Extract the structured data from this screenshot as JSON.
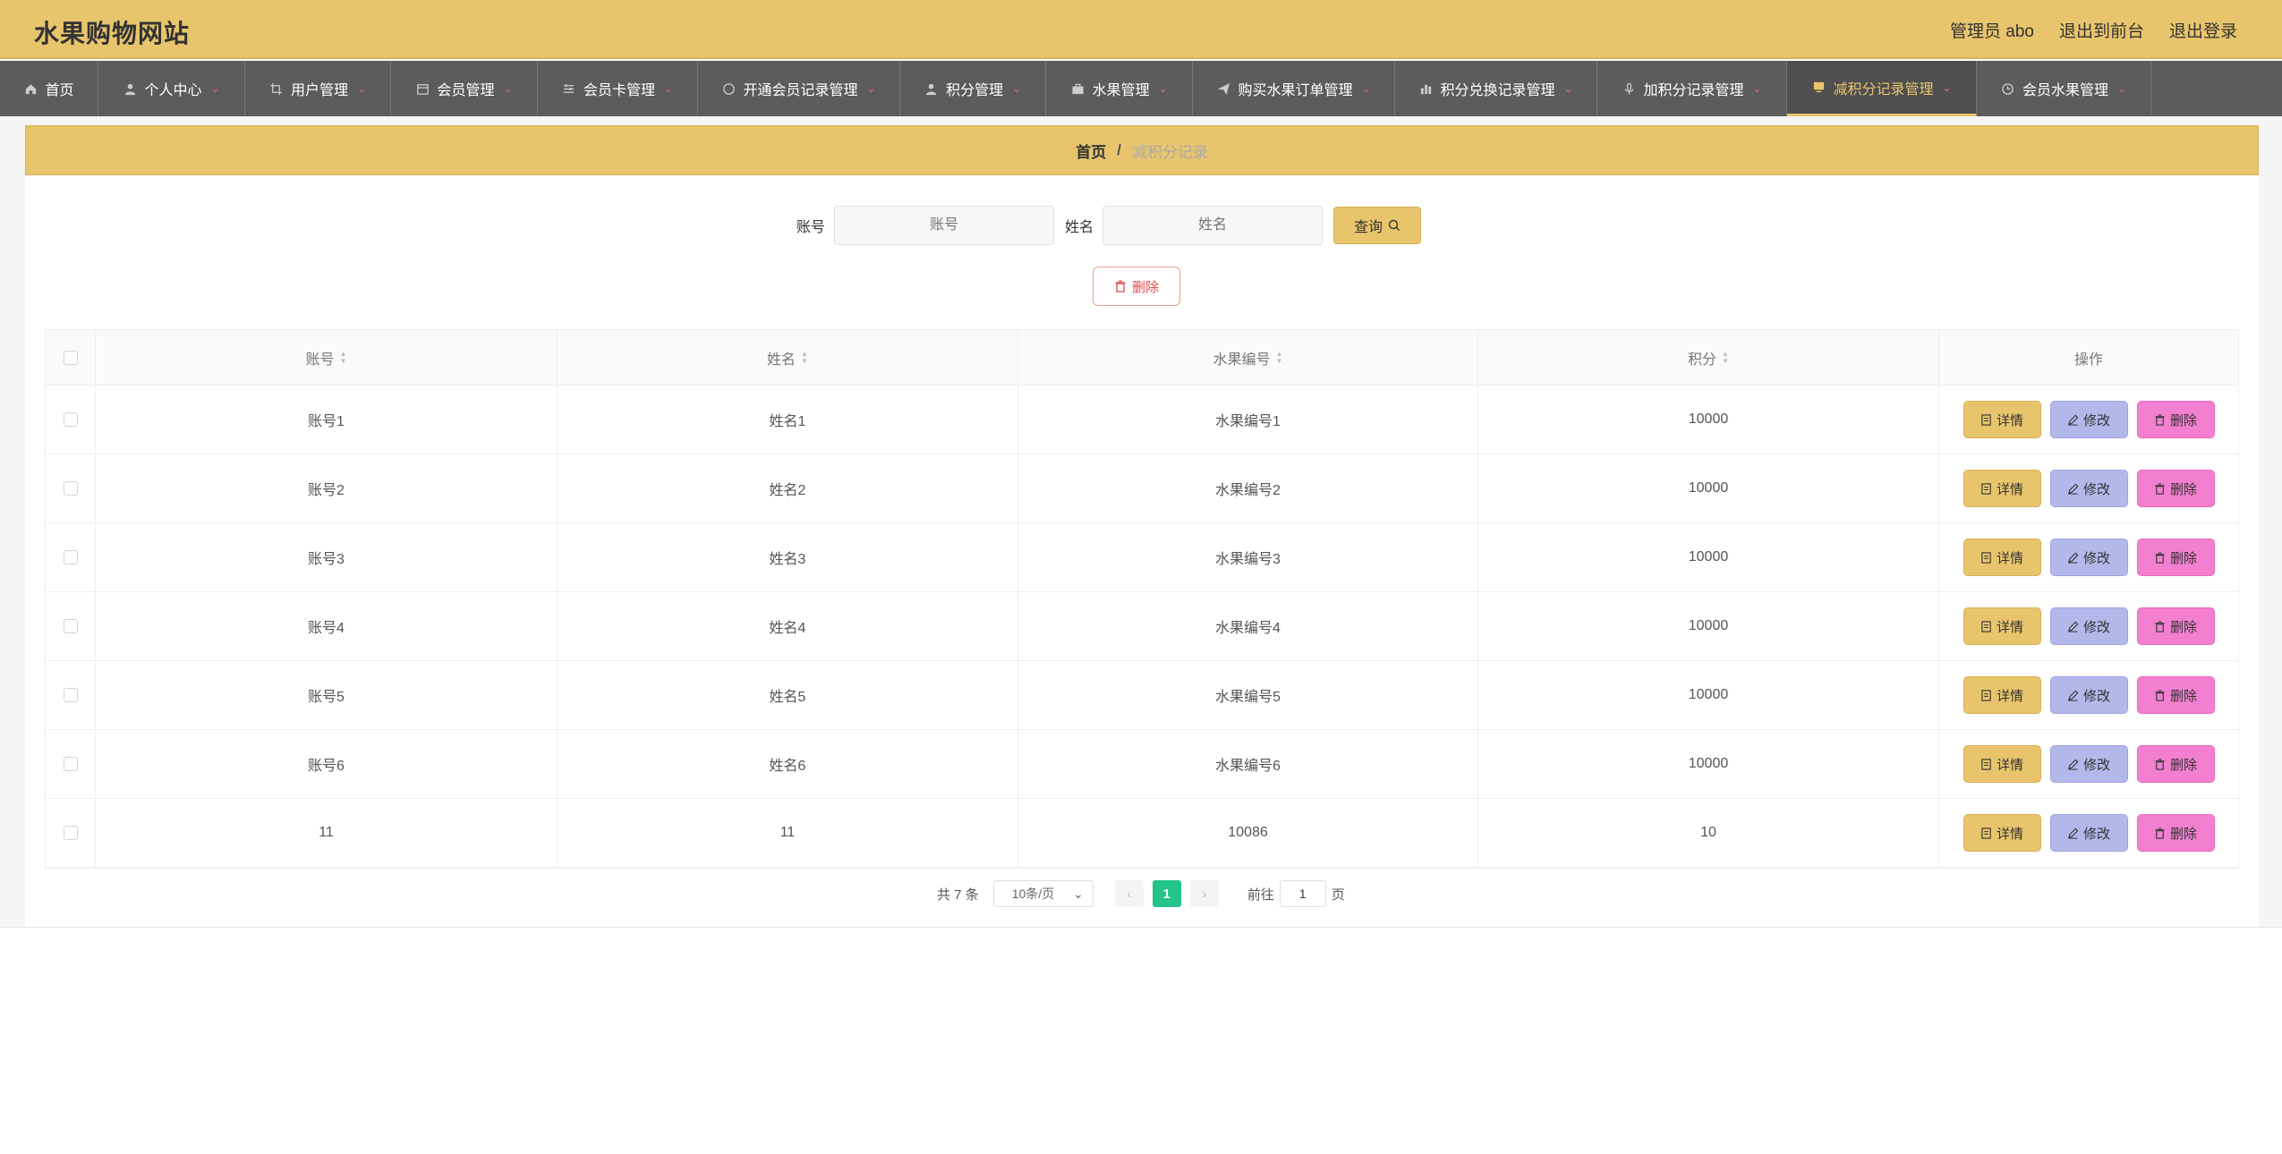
{
  "header": {
    "site_title": "水果购物网站",
    "admin_label": "管理员 abo",
    "front_link": "退出到前台",
    "logout_link": "退出登录"
  },
  "colors": {
    "accent": "#e8c46c",
    "nav_bg": "#5c5c5c",
    "detail_btn": "#e8c46c",
    "edit_btn": "#b3b8ea",
    "delete_btn": "#f27fd0",
    "page_active": "#22c48a"
  },
  "nav": [
    {
      "label": "首页",
      "icon": "home-icon",
      "width": 110,
      "dropdown": false
    },
    {
      "label": "个人中心",
      "icon": "user-icon",
      "width": 164,
      "dropdown": true
    },
    {
      "label": "用户管理",
      "icon": "crop-icon",
      "width": 163,
      "dropdown": true
    },
    {
      "label": "会员管理",
      "icon": "calendar-icon",
      "width": 164,
      "dropdown": true
    },
    {
      "label": "会员卡管理",
      "icon": "sliders-icon",
      "width": 179,
      "dropdown": true
    },
    {
      "label": "开通会员记录管理",
      "icon": "compass-icon",
      "width": 226,
      "dropdown": true
    },
    {
      "label": "积分管理",
      "icon": "user-icon",
      "width": 163,
      "dropdown": true
    },
    {
      "label": "水果管理",
      "icon": "briefcase-icon",
      "width": 164,
      "dropdown": true
    },
    {
      "label": "购买水果订单管理",
      "icon": "send-icon",
      "width": 226,
      "dropdown": true
    },
    {
      "label": "积分兑换记录管理",
      "icon": "chart-icon",
      "width": 226,
      "dropdown": true
    },
    {
      "label": "加积分记录管理",
      "icon": "mic-icon",
      "width": 212,
      "dropdown": true
    },
    {
      "label": "减积分记录管理",
      "icon": "monitor-icon",
      "width": 212,
      "dropdown": true,
      "active": true
    },
    {
      "label": "会员水果管理",
      "icon": "clock-icon",
      "width": 195,
      "dropdown": true
    }
  ],
  "breadcrumb": {
    "home": "首页",
    "sep": "/",
    "current": "减积分记录"
  },
  "search": {
    "account_label": "账号",
    "account_placeholder": "账号",
    "name_label": "姓名",
    "name_placeholder": "姓名",
    "query_label": "查询"
  },
  "bulk_delete_label": "删除",
  "table": {
    "headers": [
      "账号",
      "姓名",
      "水果编号",
      "积分",
      "操作"
    ],
    "rows": [
      [
        "账号1",
        "姓名1",
        "水果编号1",
        "10000"
      ],
      [
        "账号2",
        "姓名2",
        "水果编号2",
        "10000"
      ],
      [
        "账号3",
        "姓名3",
        "水果编号3",
        "10000"
      ],
      [
        "账号4",
        "姓名4",
        "水果编号4",
        "10000"
      ],
      [
        "账号5",
        "姓名5",
        "水果编号5",
        "10000"
      ],
      [
        "账号6",
        "姓名6",
        "水果编号6",
        "10000"
      ],
      [
        "11",
        "11",
        "10086",
        "10"
      ]
    ],
    "actions": {
      "detail": "详情",
      "edit": "修改",
      "delete": "删除"
    }
  },
  "pagination": {
    "total": "共 7 条",
    "page_size": "10条/页",
    "current_page": "1",
    "goto_label": "前往",
    "goto_value": "1",
    "page_suffix": "页"
  }
}
